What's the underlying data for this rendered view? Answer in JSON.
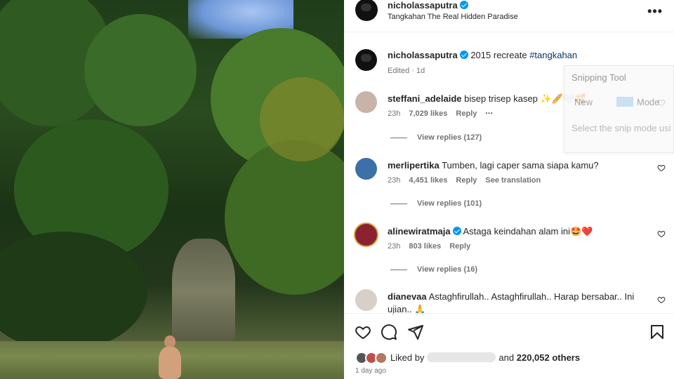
{
  "post": {
    "owner": "nicholassaputra",
    "location": "Tangkahan The Real Hidden Paradise",
    "more_icon": "more-horizontal-icon",
    "caption_text": "2015 recreate",
    "caption_tag": "#tangkahan",
    "caption_meta": "Edited · 1d"
  },
  "comments": [
    {
      "user": "steffani_adelaide",
      "text": "bisep trisep kasep ✨🥖🤍🥰",
      "time": "23h",
      "likes": "7,029 likes",
      "reply": "Reply",
      "extra": "",
      "view_replies": "View replies (127)",
      "verified": false
    },
    {
      "user": "merlipertika",
      "text": "Tumben, lagi caper sama siapa kamu?",
      "time": "23h",
      "likes": "4,451 likes",
      "reply": "Reply",
      "extra": "See translation",
      "view_replies": "View replies (101)",
      "verified": false
    },
    {
      "user": "alinewiratmaja",
      "text": "Astaga keindahan alam ini🤩❤️",
      "time": "23h",
      "likes": "803 likes",
      "reply": "Reply",
      "extra": "",
      "view_replies": "View replies (16)",
      "verified": true
    },
    {
      "user": "dianevaa",
      "text": "Astaghfirullah.. Astaghfirullah.. Harap bersabar.. Ini ujian.. 🙏",
      "verified": false
    }
  ],
  "comment_more": "···",
  "snipping_tool": {
    "title": "Snipping Tool",
    "new_label": "New",
    "mode_label": "Mode",
    "help_text": "Select the snip mode usi New button."
  },
  "actions": {
    "icons": [
      "heart-icon",
      "comment-icon",
      "share-icon",
      "bookmark-icon"
    ],
    "liked_by_prefix": "Liked by",
    "liked_by_suffix": "and",
    "likes_count": "220,052 others",
    "time": "1 day ago"
  },
  "colors": {
    "accent": "#0095f6",
    "heart_red": "#ed4956",
    "text": "#262626",
    "muted": "#737373"
  }
}
